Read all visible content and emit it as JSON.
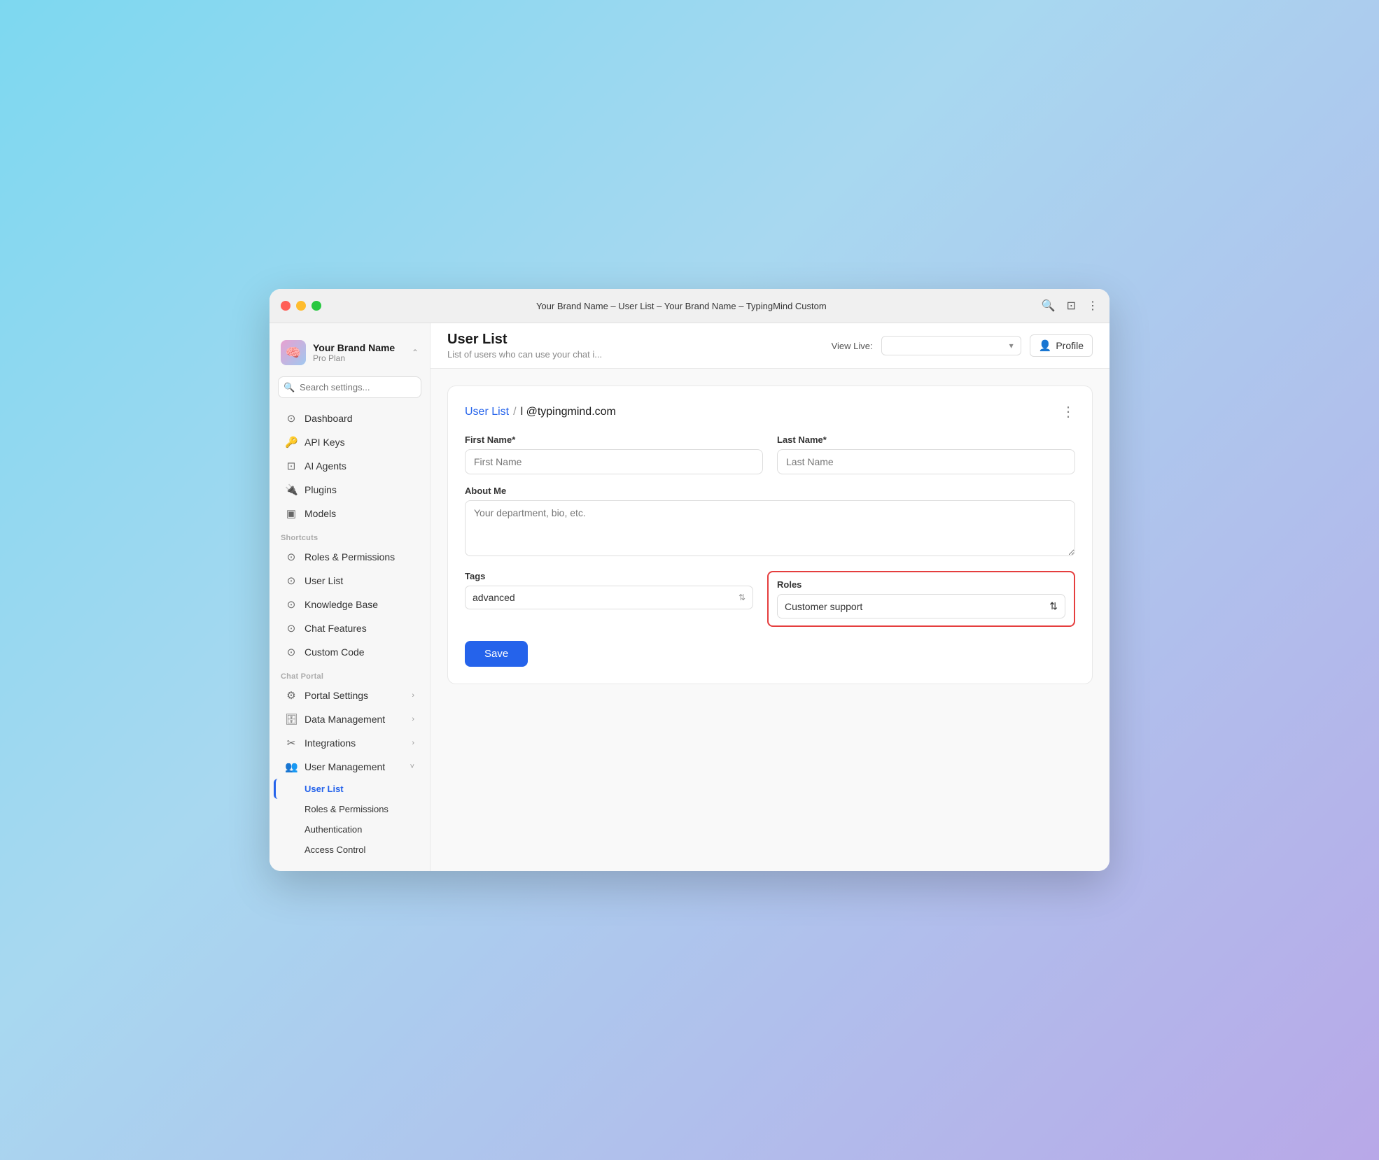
{
  "window": {
    "title": "Your Brand Name – User List – Your Brand Name – TypingMind Custom"
  },
  "sidebar": {
    "brand": {
      "name": "Your Brand Name",
      "plan": "Pro Plan",
      "avatar_emoji": "🧠"
    },
    "search_placeholder": "Search settings...",
    "nav_items": [
      {
        "id": "dashboard",
        "label": "Dashboard",
        "icon": "⊙"
      },
      {
        "id": "api-keys",
        "label": "API Keys",
        "icon": "🔑"
      },
      {
        "id": "ai-agents",
        "label": "AI Agents",
        "icon": "⊡"
      },
      {
        "id": "plugins",
        "label": "Plugins",
        "icon": "🔌"
      },
      {
        "id": "models",
        "label": "Models",
        "icon": "▣"
      }
    ],
    "shortcuts_label": "Shortcuts",
    "shortcut_items": [
      {
        "id": "roles-permissions",
        "label": "Roles & Permissions",
        "icon": "⊙"
      },
      {
        "id": "user-list",
        "label": "User List",
        "icon": "⊙"
      },
      {
        "id": "knowledge-base",
        "label": "Knowledge Base",
        "icon": "⊙"
      },
      {
        "id": "chat-features",
        "label": "Chat Features",
        "icon": "⊙"
      },
      {
        "id": "custom-code",
        "label": "Custom Code",
        "icon": "⊙"
      }
    ],
    "chat_portal_label": "Chat Portal",
    "portal_items": [
      {
        "id": "portal-settings",
        "label": "Portal Settings",
        "expandable": true
      },
      {
        "id": "data-management",
        "label": "Data Management",
        "expandable": true
      },
      {
        "id": "integrations",
        "label": "Integrations",
        "expandable": true
      },
      {
        "id": "user-management",
        "label": "User Management",
        "expandable": true,
        "expanded": true
      }
    ],
    "user_management_sub": [
      {
        "id": "sub-user-list",
        "label": "User List",
        "active": true
      },
      {
        "id": "sub-roles-permissions",
        "label": "Roles & Permissions"
      },
      {
        "id": "sub-authentication",
        "label": "Authentication"
      },
      {
        "id": "sub-access-control",
        "label": "Access Control"
      }
    ]
  },
  "topbar": {
    "page_title": "User List",
    "page_subtitle": "List of users who can use your chat i...",
    "view_live_label": "View Live:",
    "profile_label": "Profile"
  },
  "form": {
    "breadcrumb_link": "User List",
    "breadcrumb_sep": "/",
    "breadcrumb_email": "l          @typingmind.com",
    "first_name_label": "First Name*",
    "first_name_placeholder": "First Name",
    "last_name_label": "Last Name*",
    "last_name_placeholder": "Last Name",
    "about_label": "About Me",
    "about_placeholder": "Your department, bio, etc.",
    "tags_label": "Tags",
    "tags_value": "advanced",
    "roles_label": "Roles",
    "roles_value": "Customer support",
    "save_label": "Save"
  }
}
